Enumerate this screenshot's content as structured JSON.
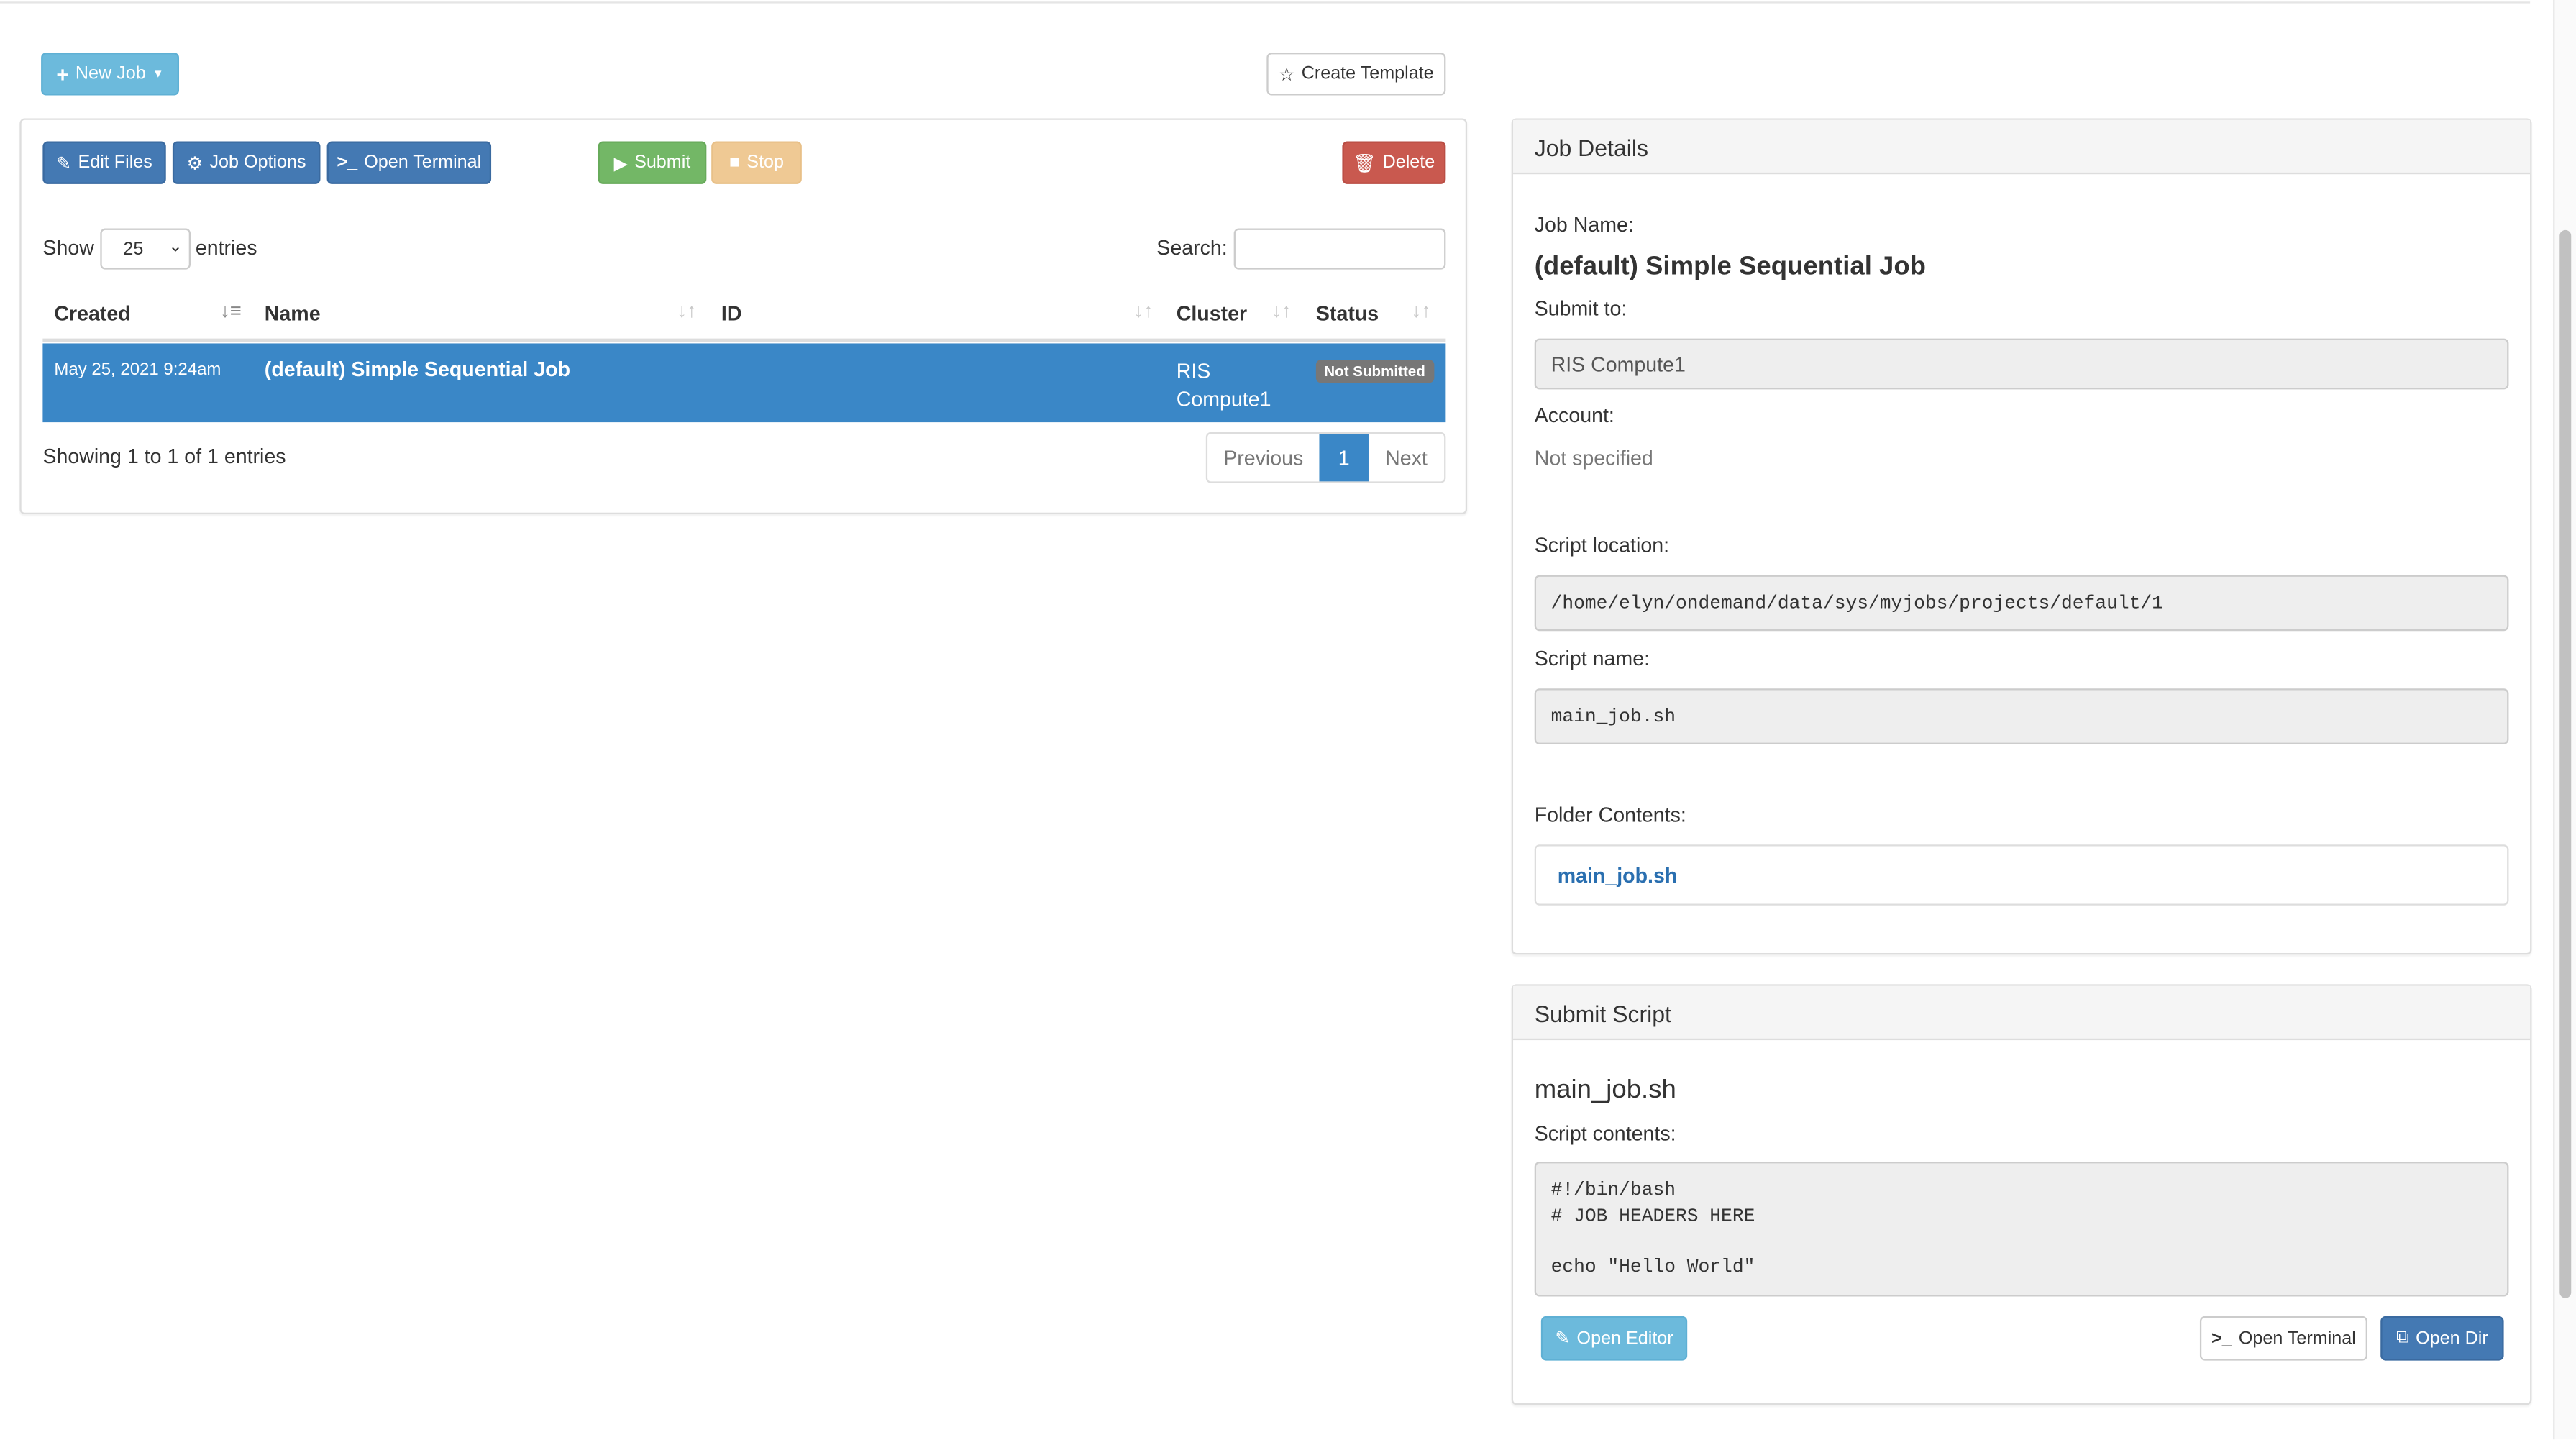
{
  "toolbar": {
    "new_job": "New Job",
    "create_template": "Create Template"
  },
  "jobs_panel": {
    "actions": {
      "edit_files": "Edit Files",
      "job_options": "Job Options",
      "open_terminal": "Open Terminal",
      "submit": "Submit",
      "stop": "Stop",
      "delete": "Delete"
    },
    "show_label": "Show",
    "entries_label": "entries",
    "page_length": "25",
    "search_label": "Search:",
    "search_value": "",
    "columns": [
      "Created",
      "Name",
      "ID",
      "Cluster",
      "Status"
    ],
    "rows": [
      {
        "created": "May 25, 2021 9:24am",
        "name": "(default) Simple Sequential Job",
        "id": "",
        "cluster": "RIS Compute1",
        "status": "Not Submitted"
      }
    ],
    "info": "Showing 1 to 1 of 1 entries",
    "pagination": {
      "previous": "Previous",
      "current": "1",
      "next": "Next"
    }
  },
  "job_details": {
    "title": "Job Details",
    "job_name_label": "Job Name:",
    "job_name": "(default) Simple Sequential Job",
    "submit_to_label": "Submit to:",
    "submit_to": "RIS Compute1",
    "account_label": "Account:",
    "account": "Not specified",
    "script_location_label": "Script location:",
    "script_location": "/home/elyn/ondemand/data/sys/myjobs/projects/default/1",
    "script_name_label": "Script name:",
    "script_name": "main_job.sh",
    "folder_contents_label": "Folder Contents:",
    "folder_files": [
      "main_job.sh"
    ]
  },
  "submit_script": {
    "title": "Submit Script",
    "file_name": "main_job.sh",
    "contents_label": "Script contents:",
    "contents": "#!/bin/bash\n# JOB HEADERS HERE\n\necho \"Hello World\"",
    "open_editor": "Open Editor",
    "open_terminal": "Open Terminal",
    "open_dir": "Open Dir"
  },
  "colors": {
    "primary": "#4479b3",
    "selected_row": "#3a87c7",
    "success": "#73b766",
    "warning": "#efc994",
    "danger": "#c9594f",
    "info": "#6cbadc"
  }
}
